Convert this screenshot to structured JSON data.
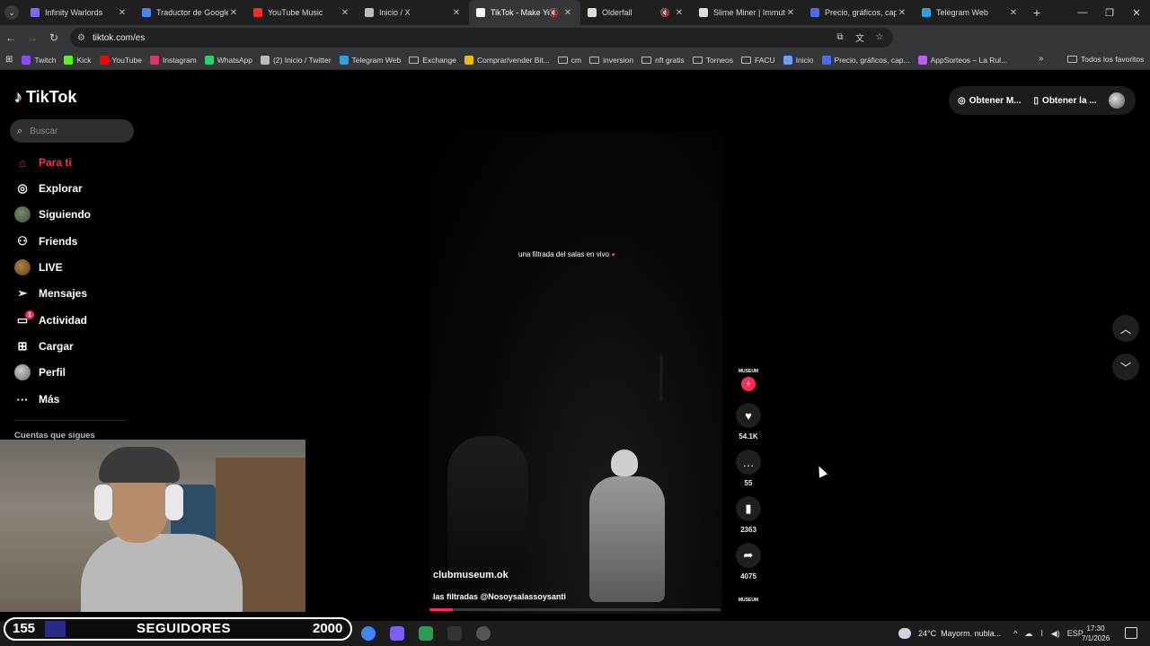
{
  "browser": {
    "tabs": [
      {
        "label": "Infinity Warlords",
        "color": "#7a6cff",
        "active": false
      },
      {
        "label": "Traductor de Google",
        "color": "#4a86f0",
        "active": false
      },
      {
        "label": "YouTube Music",
        "color": "#ff2a2a",
        "active": false
      },
      {
        "label": "Inicio / X",
        "color": "#bbbbbb",
        "active": false
      },
      {
        "label": "TikTok - Make Yo",
        "color": "#ffffff",
        "active": true
      },
      {
        "label": "Olderfall",
        "color": "#dddddd",
        "active": false
      },
      {
        "label": "Slime Miner | Immuta",
        "color": "#dddddd",
        "active": false
      },
      {
        "label": "Precio, gráficos, capi",
        "color": "#4a6cf0",
        "active": false
      },
      {
        "label": "Telegram Web",
        "color": "#2aa3e0",
        "active": false
      }
    ],
    "url": "tiktok.com/es",
    "bookmarks": [
      {
        "label": "Twitch",
        "color": "#9146ff",
        "type": "site"
      },
      {
        "label": "Kick",
        "color": "#53fc18",
        "type": "site"
      },
      {
        "label": "YouTube",
        "color": "#ff0000",
        "type": "site"
      },
      {
        "label": "Instagram",
        "color": "#e1306c",
        "type": "site"
      },
      {
        "label": "WhatsApp",
        "color": "#25d366",
        "type": "site"
      },
      {
        "label": "(2) Inicio / Twitter",
        "color": "#bbbbbb",
        "type": "site"
      },
      {
        "label": "Telegram Web",
        "color": "#2aa3e0",
        "type": "site"
      },
      {
        "label": "Exchange",
        "color": "#bbbbbb",
        "type": "folder"
      },
      {
        "label": "Comprar/vender Bit...",
        "color": "#f0b90b",
        "type": "site"
      },
      {
        "label": "cm",
        "color": "#bbbbbb",
        "type": "folder"
      },
      {
        "label": "inversion",
        "color": "#bbbbbb",
        "type": "folder"
      },
      {
        "label": "nft gratis",
        "color": "#bbbbbb",
        "type": "folder"
      },
      {
        "label": "Torneos",
        "color": "#bbbbbb",
        "type": "folder"
      },
      {
        "label": "FACU",
        "color": "#bbbbbb",
        "type": "folder"
      },
      {
        "label": "Inicio",
        "color": "#66a0ff",
        "type": "site"
      },
      {
        "label": "Precio, gráficos, cap...",
        "color": "#4a6cf0",
        "type": "site"
      },
      {
        "label": "AppSorteos – La Rul...",
        "color": "#c05aff",
        "type": "site"
      }
    ],
    "all_bookmarks": "Todos los favoritos"
  },
  "tiktok": {
    "logo": "TikTok",
    "search_placeholder": "Buscar",
    "nav": [
      {
        "label": "Para ti"
      },
      {
        "label": "Explorar"
      },
      {
        "label": "Siguiendo"
      },
      {
        "label": "Friends"
      },
      {
        "label": "LIVE"
      },
      {
        "label": "Mensajes"
      },
      {
        "label": "Actividad",
        "badge": "1"
      },
      {
        "label": "Cargar"
      },
      {
        "label": "Perfil"
      },
      {
        "label": "Más"
      }
    ],
    "following_title": "Cuentas que sigues",
    "top_right": {
      "get_m": "Obtener M...",
      "get_app": "Obtener la ..."
    },
    "video": {
      "overlay_text": "una filtrada del salas en vivo",
      "author": "clubmuseum.ok",
      "description": "las filtradas @Nosoysalassoysanti",
      "avatar_text": "MUSEUM",
      "music_text": "MUSEUM",
      "likes": "54.1K",
      "comments": "55",
      "saves": "2363",
      "shares": "4075",
      "progress": 0.08
    }
  },
  "stream_overlay": {
    "followers": "155",
    "label": "SEGUIDORES",
    "goal": "2000",
    "progress": 0.0775
  },
  "taskbar": {
    "weather_temp": "24°C",
    "weather_text": "Mayorm. nubla...",
    "lang": "ESP",
    "time": "17:30",
    "date": "7/1/2026"
  }
}
